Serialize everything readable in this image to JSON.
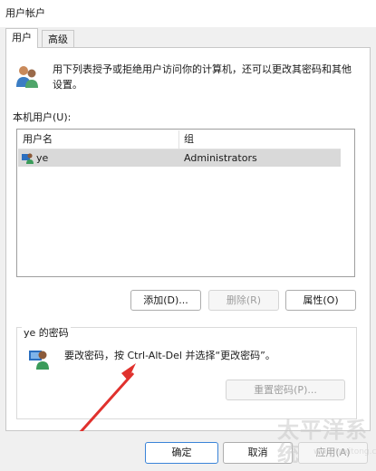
{
  "window": {
    "title": "用户帐户"
  },
  "tabs": [
    {
      "label": "用户"
    },
    {
      "label": "高级"
    }
  ],
  "intro": {
    "text": "用下列表授予或拒绝用户访问你的计算机，还可以更改其密码和其他设置。"
  },
  "users_section": {
    "label": "本机用户(U):"
  },
  "users_table": {
    "columns": [
      "用户名",
      "组"
    ],
    "rows": [
      {
        "name": "ye",
        "group": "Administrators",
        "selected": true
      }
    ]
  },
  "user_actions": {
    "add": "添加(D)...",
    "remove": "删除(R)",
    "properties": "属性(O)"
  },
  "password_group": {
    "title": "ye 的密码",
    "text": "要改密码，按 Ctrl-Alt-Del 并选择“更改密码”。",
    "reset_button": "重置密码(P)..."
  },
  "footer": {
    "ok": "确定",
    "cancel": "取消",
    "apply": "应用(A)"
  },
  "watermark": {
    "text": "太平洋系统",
    "subtext": "www.tpxitong.com"
  },
  "colors": {
    "arrow": "#e0312d",
    "selected_row": "#d9d9d9"
  }
}
